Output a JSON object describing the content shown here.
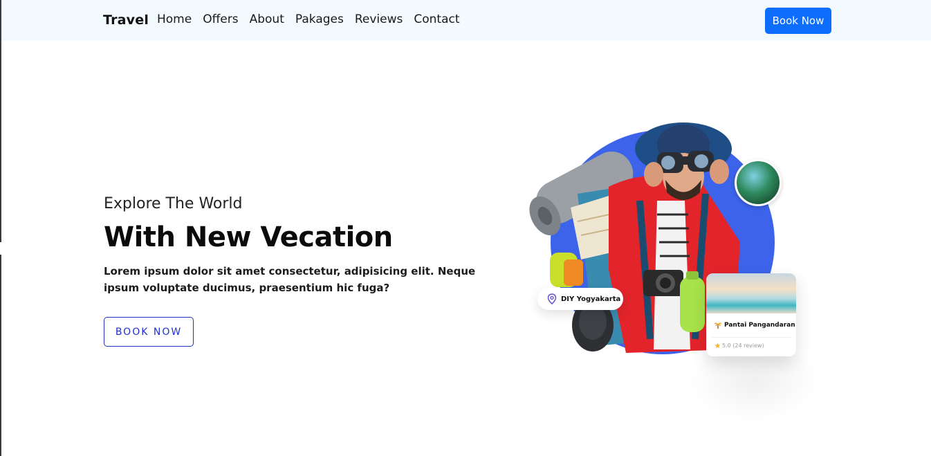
{
  "nav": {
    "brand": "Travel",
    "links": [
      "Home",
      "Offers",
      "About",
      "Pakages",
      "Reviews",
      "Contact"
    ],
    "cta": "Book Now"
  },
  "hero": {
    "subtitle": "Explore The World",
    "title": "With New Vecation",
    "description": "Lorem ipsum dolor sit amet consectetur, adipisicing elit. Neque ipsum voluptate ducimus, praesentium hic fuga?",
    "button": "BOOK NOW"
  },
  "illustration": {
    "location_pill": "DIY Yogyakarta",
    "card_place": "Pantai Pangandaran",
    "card_rating": "5.0 (24 review)"
  },
  "colors": {
    "primary": "#0d6efd",
    "accent_circle": "#3c63e9",
    "outline_button": "#1f2fd0",
    "nav_bg": "#f3fafd"
  },
  "icons": {
    "location": "map-pin-icon",
    "place": "palm-tree-icon",
    "rating": "star-icon"
  }
}
